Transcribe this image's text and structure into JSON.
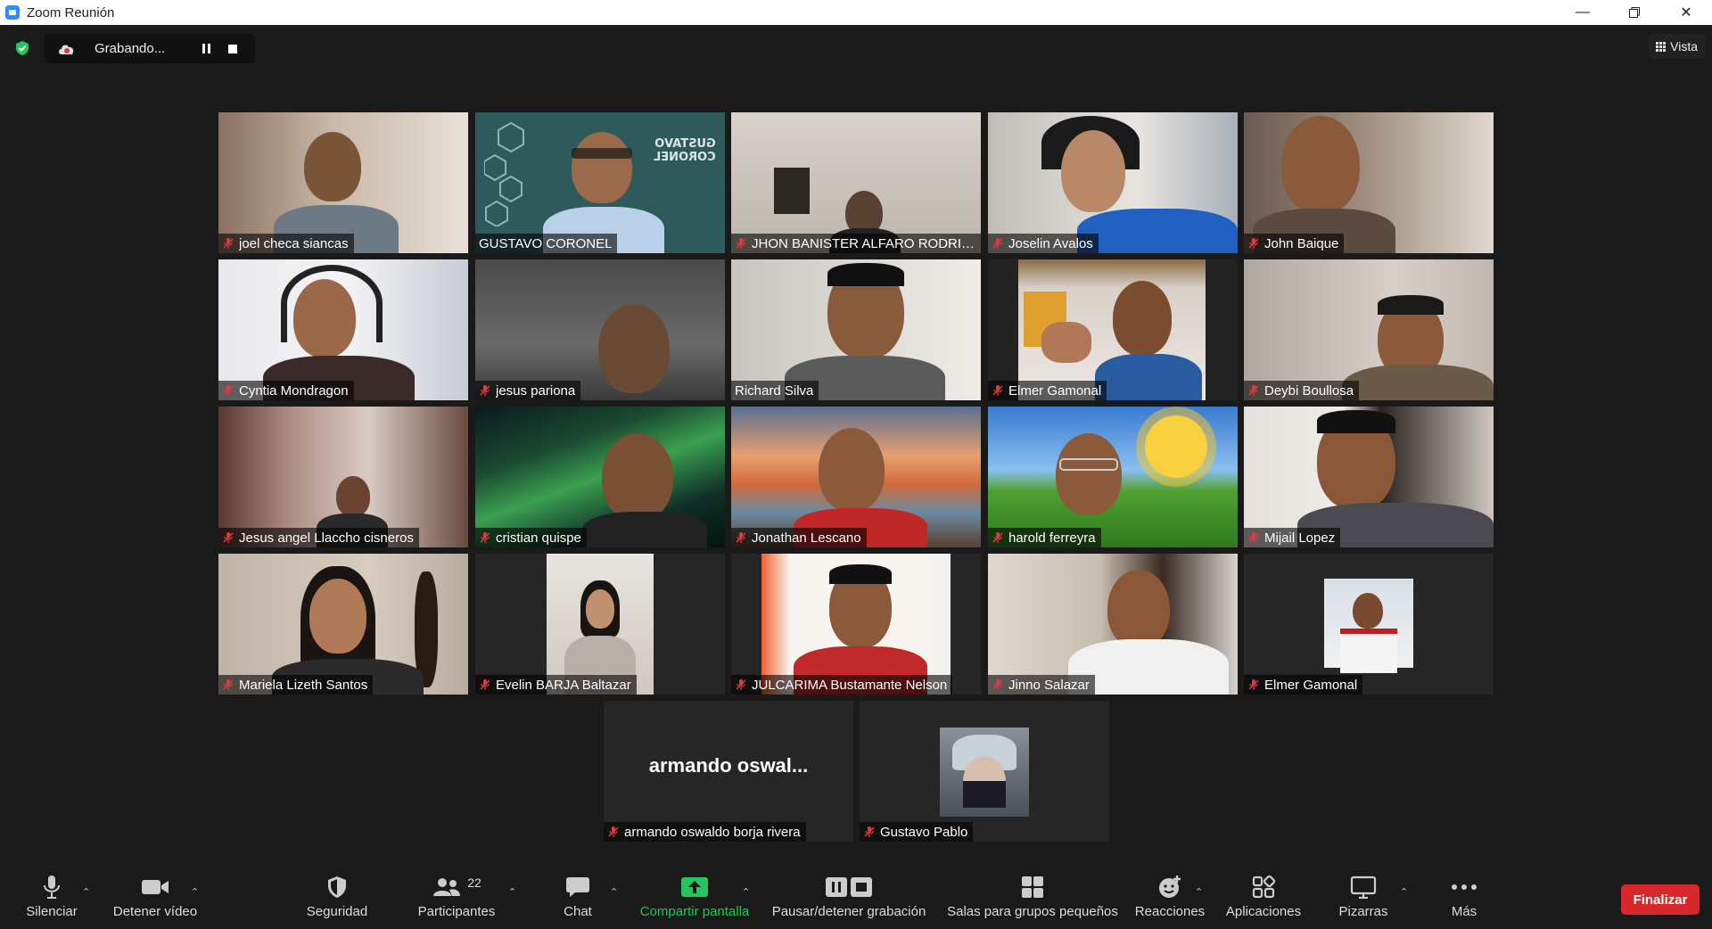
{
  "window": {
    "title": "Zoom Reunión"
  },
  "recording": {
    "status": "Grabando..."
  },
  "view": {
    "label": "Vista"
  },
  "participants": [
    {
      "name": "joel checa siancas",
      "muted": true
    },
    {
      "name": "GUSTAVO CORONEL",
      "muted": false
    },
    {
      "name": "JHON BANISTER ALFARO RODRIG...",
      "muted": true
    },
    {
      "name": "Joselin Avalos",
      "muted": true
    },
    {
      "name": "John Baique",
      "muted": true
    },
    {
      "name": "Cyntia Mondragon",
      "muted": true
    },
    {
      "name": "jesus pariona",
      "muted": true
    },
    {
      "name": "Richard Silva",
      "muted": false,
      "speaking": true
    },
    {
      "name": "Elmer Gamonal",
      "muted": true
    },
    {
      "name": "Deybi Boullosa",
      "muted": true
    },
    {
      "name": "Jesus angel Llaccho cisneros",
      "muted": true
    },
    {
      "name": "cristian quispe",
      "muted": true
    },
    {
      "name": "Jonathan Lescano",
      "muted": true
    },
    {
      "name": "harold ferreyra",
      "muted": true
    },
    {
      "name": "Mijail Lopez",
      "muted": true
    },
    {
      "name": "Mariela Lizeth Santos",
      "muted": true
    },
    {
      "name": "Evelin BARJA  Baltazar",
      "muted": true
    },
    {
      "name": "JULCARIMA Bustamante Nelson",
      "muted": true
    },
    {
      "name": "Jinno Salazar",
      "muted": true
    },
    {
      "name": "Elmer Gamonal",
      "muted": true
    },
    {
      "name": "armando oswaldo borja rivera",
      "muted": true,
      "video_off_label": "armando  oswal..."
    },
    {
      "name": "Gustavo Pablo",
      "muted": true
    }
  ],
  "toolbar": {
    "mute": "Silenciar",
    "video": "Detener vídeo",
    "security": "Seguridad",
    "participants": "Participantes",
    "participants_count": "22",
    "chat": "Chat",
    "share": "Compartir pantalla",
    "recording": "Pausar/detener grabación",
    "breakout": "Salas para grupos pequeños",
    "reactions": "Reacciones",
    "apps": "Aplicaciones",
    "whiteboards": "Pizarras",
    "more": "Más",
    "end": "Finalizar"
  },
  "colors": {
    "speaker_border": "#e6e65a",
    "end_button": "#d9282c",
    "share_green": "#22c55e",
    "muted_red": "#e0393e"
  }
}
